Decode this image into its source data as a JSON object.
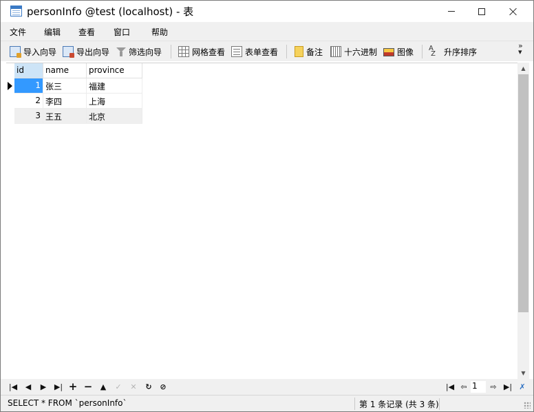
{
  "window": {
    "title": "personInfo @test (localhost) - 表"
  },
  "menu": {
    "items": [
      "文件",
      "编辑",
      "查看",
      "窗口",
      "帮助"
    ]
  },
  "toolbar": {
    "buttons": [
      {
        "label": "导入向导",
        "icon": "import-wizard-icon"
      },
      {
        "label": "导出向导",
        "icon": "export-wizard-icon"
      },
      {
        "label": "筛选向导",
        "icon": "filter-icon"
      },
      {
        "label": "网格查看",
        "icon": "grid-view-icon"
      },
      {
        "label": "表单查看",
        "icon": "form-view-icon"
      },
      {
        "label": "备注",
        "icon": "memo-icon"
      },
      {
        "label": "十六进制",
        "icon": "hex-icon"
      },
      {
        "label": "图像",
        "icon": "image-icon"
      },
      {
        "label": "升序排序",
        "icon": "sort-ascending-icon"
      }
    ],
    "more": "»"
  },
  "table": {
    "columns": [
      "id",
      "name",
      "province"
    ],
    "rows": [
      {
        "id": "1",
        "name": "张三",
        "province": "福建"
      },
      {
        "id": "2",
        "name": "李四",
        "province": "上海"
      },
      {
        "id": "3",
        "name": "王五",
        "province": "北京"
      }
    ],
    "selected_row": 1
  },
  "navigation": {
    "page": "1"
  },
  "status": {
    "sql": "SELECT * FROM `personInfo`",
    "record_info": "第 1 条记录 (共 3 条)"
  },
  "colors": {
    "selected_cell": "#3399ff",
    "header_selected": "#cde4f7",
    "chrome_background": "#f0f0f0"
  }
}
